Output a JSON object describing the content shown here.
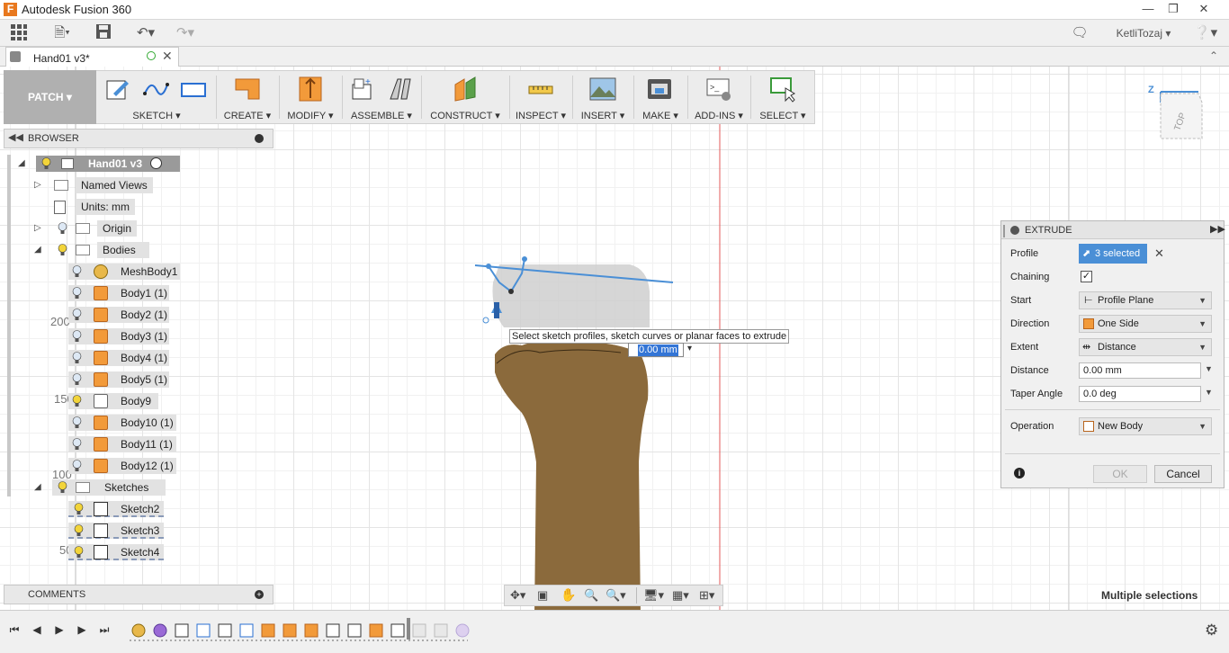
{
  "app": {
    "title": "Autodesk Fusion 360",
    "logo_letter": "F"
  },
  "user": {
    "name": "KetliTozaj"
  },
  "document": {
    "tab_title": "Hand01 v3*"
  },
  "toolbar": {
    "workspace": "PATCH",
    "groups": [
      "SKETCH",
      "CREATE",
      "MODIFY",
      "ASSEMBLE",
      "CONSTRUCT",
      "INSPECT",
      "INSERT",
      "MAKE",
      "ADD-INS",
      "SELECT"
    ]
  },
  "browser": {
    "title": "BROWSER",
    "root": "Hand01 v3",
    "named_views": "Named Views",
    "units": "Units: mm",
    "origin": "Origin",
    "bodies": "Bodies",
    "body_items": [
      "MeshBody1",
      "Body1 (1)",
      "Body2 (1)",
      "Body3 (1)",
      "Body4 (1)",
      "Body5 (1)",
      "Body9",
      "Body10 (1)",
      "Body11 (1)",
      "Body12 (1)"
    ],
    "sketches": "Sketches",
    "sketch_items": [
      "Sketch2",
      "Sketch3",
      "Sketch4"
    ]
  },
  "comments": {
    "title": "COMMENTS"
  },
  "viewport": {
    "tooltip": "Select sketch profiles, sketch curves or planar faces to extrude",
    "distance_value": "0.00 mm",
    "ruler_labels": [
      "200",
      "150",
      "100",
      "50"
    ],
    "viewcube_label": "TOP",
    "axis_label": "Z",
    "status": "Multiple selections"
  },
  "extrude": {
    "title": "EXTRUDE",
    "profile_label": "Profile",
    "profile_value": "3 selected",
    "chaining_label": "Chaining",
    "start_label": "Start",
    "start_value": "Profile Plane",
    "direction_label": "Direction",
    "direction_value": "One Side",
    "extent_label": "Extent",
    "extent_value": "Distance",
    "distance_label": "Distance",
    "distance_value": "0.00 mm",
    "taper_label": "Taper Angle",
    "taper_value": "0.0 deg",
    "operation_label": "Operation",
    "operation_value": "New Body",
    "ok_label": "OK",
    "cancel_label": "Cancel"
  },
  "colors": {
    "accent": "#e8781e",
    "selection": "#4a8fd6",
    "body": "#8b6a3c"
  }
}
